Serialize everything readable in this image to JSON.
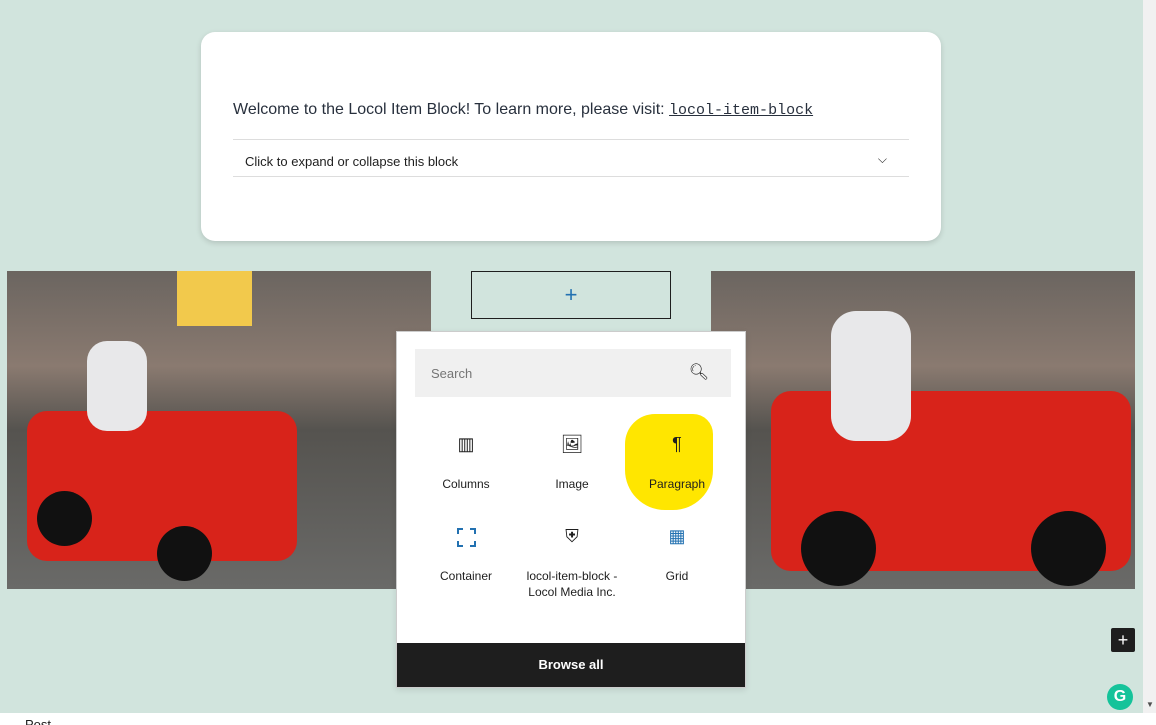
{
  "card": {
    "welcome_text": "Welcome to the Locol Item Block! To learn more, please visit: ",
    "link": "locol-item-block",
    "toggle_label": "Click to expand or collapse this block"
  },
  "inserter": {
    "search_placeholder": "Search",
    "items": [
      {
        "label": "Columns",
        "icon": "columns-icon"
      },
      {
        "label": "Image",
        "icon": "image-icon"
      },
      {
        "label": "Paragraph",
        "icon": "paragraph-icon"
      },
      {
        "label": "Container",
        "icon": "container-icon"
      },
      {
        "label": "locol-item-block - Locol Media Inc.",
        "icon": "shield-icon"
      },
      {
        "label": "Grid",
        "icon": "grid-icon"
      }
    ],
    "browse_all": "Browse all",
    "highlight_color": "#ffe600"
  },
  "add_block_symbol": "+",
  "footer": {
    "label": "Post"
  },
  "colors": {
    "background": "#d1e4dd",
    "accent": "#2271b1"
  }
}
